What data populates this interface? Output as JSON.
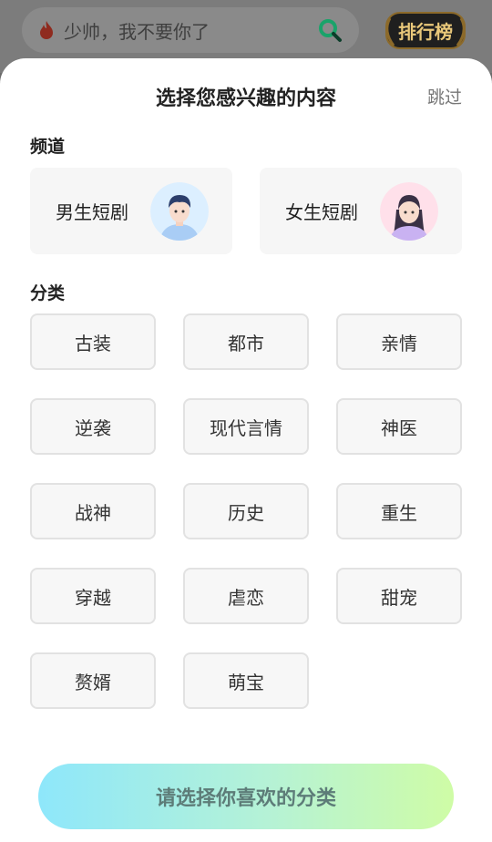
{
  "header": {
    "search_placeholder": "少帅，我不要你了",
    "rank_label": "排行榜"
  },
  "sheet": {
    "title": "选择您感兴趣的内容",
    "skip_label": "跳过",
    "channel_section_label": "频道",
    "channels": [
      {
        "label": "男生短剧",
        "avatar": "male-avatar-icon"
      },
      {
        "label": "女生短剧",
        "avatar": "female-avatar-icon"
      }
    ],
    "category_section_label": "分类",
    "categories": [
      "古装",
      "都市",
      "亲情",
      "逆袭",
      "现代言情",
      "神医",
      "战神",
      "历史",
      "重生",
      "穿越",
      "虐恋",
      "甜宠",
      "赘婿",
      "萌宝"
    ],
    "cta_label": "请选择你喜欢的分类"
  },
  "colors": {
    "cta_gradient_start": "#8ee7fb",
    "cta_gradient_end": "#cffca6",
    "search_icon": "#1aa36a",
    "rank_gold": "#e9c87a"
  }
}
